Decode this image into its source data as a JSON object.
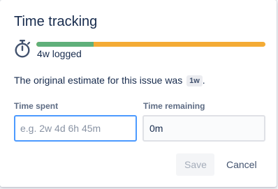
{
  "dialog": {
    "title": "Time tracking"
  },
  "progress": {
    "logged_fraction": 0.25,
    "logged_text": "4w logged",
    "colors": {
      "logged": "#5fb07a",
      "remaining": "#f4ab35"
    }
  },
  "estimate": {
    "prefix": "The original estimate for this issue was",
    "value": "1w",
    "suffix": "."
  },
  "fields": {
    "time_spent": {
      "label": "Time spent",
      "placeholder": "e.g. 2w 4d 6h 45m",
      "value": ""
    },
    "time_remaining": {
      "label": "Time remaining",
      "value": "0m"
    }
  },
  "actions": {
    "save_label": "Save",
    "cancel_label": "Cancel"
  }
}
